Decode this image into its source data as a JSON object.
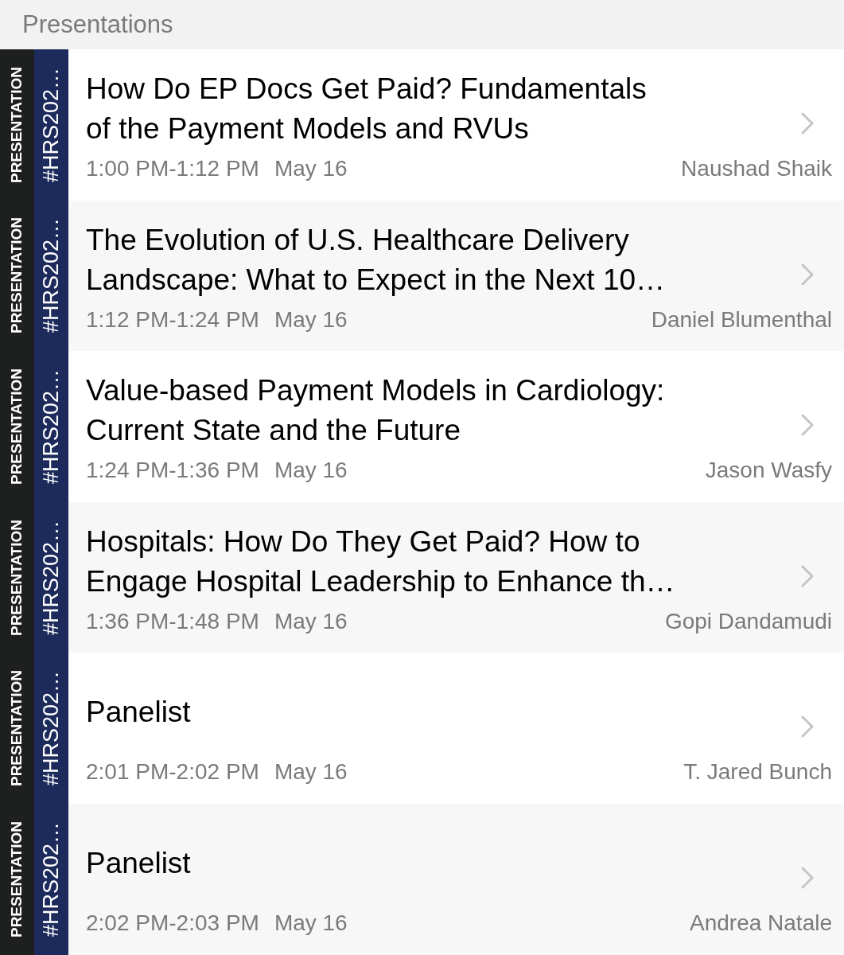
{
  "header": {
    "title": "Presentations"
  },
  "sessions": [
    {
      "type_tag": "PRESENTATION",
      "event_tag": "#HRS202…",
      "title": "How Do EP Docs Get Paid? Fundamentals\nof the Payment Models and RVUs",
      "time": "1:00 PM-1:12 PM",
      "date": "May 16",
      "speaker": "Naushad Shaik"
    },
    {
      "type_tag": "PRESENTATION",
      "event_tag": "#HRS202…",
      "title": "The Evolution of U.S. Healthcare Delivery\nLandscape: What to Expect in the Next 10…",
      "time": "1:12 PM-1:24 PM",
      "date": "May 16",
      "speaker": "Daniel Blumenthal"
    },
    {
      "type_tag": "PRESENTATION",
      "event_tag": "#HRS202…",
      "title": "Value-based Payment Models in Cardiology:\nCurrent State and the Future",
      "time": "1:24 PM-1:36 PM",
      "date": "May 16",
      "speaker": "Jason Wasfy"
    },
    {
      "type_tag": "PRESENTATION",
      "event_tag": "#HRS202…",
      "title": "Hospitals: How Do They Get Paid? How to\nEngage Hospital Leadership to Enhance th…",
      "time": "1:36 PM-1:48 PM",
      "date": "May 16",
      "speaker": "Gopi Dandamudi"
    },
    {
      "type_tag": "PRESENTATION",
      "event_tag": "#HRS202…",
      "title": "Panelist",
      "time": "2:01 PM-2:02 PM",
      "date": "May 16",
      "speaker": "T. Jared Bunch"
    },
    {
      "type_tag": "PRESENTATION",
      "event_tag": "#HRS202…",
      "title": "Panelist",
      "time": "2:02 PM-2:03 PM",
      "date": "May 16",
      "speaker": "Andrea Natale"
    }
  ]
}
